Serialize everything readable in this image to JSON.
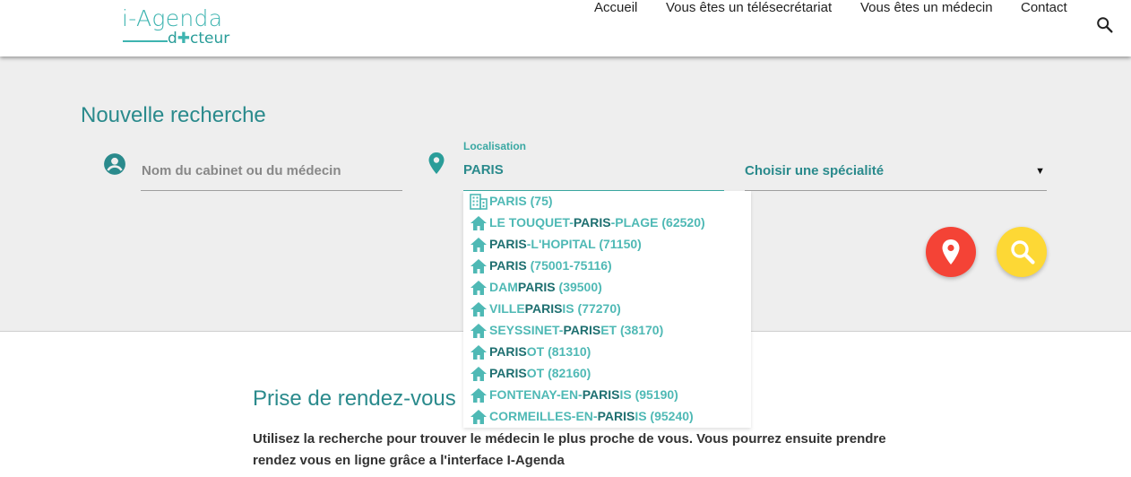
{
  "header": {
    "logo_top": "i-Agenda",
    "logo_bottom_prefix": "d",
    "logo_bottom_suffix": "cteur",
    "nav": [
      {
        "label": "Accueil"
      },
      {
        "label": "Vous êtes un télésecrétariat"
      },
      {
        "label": "Vous êtes un médecin"
      },
      {
        "label": "Contact"
      }
    ],
    "search_icon": "search-icon"
  },
  "search": {
    "title": "Nouvelle recherche",
    "doctor_placeholder": "Nom du cabinet ou du médecin",
    "doctor_icon": "account-circle-icon",
    "location_icon": "location-pin-icon",
    "location_label": "Localisation",
    "location_value": "PARIS",
    "specialty_value": "Choisir une spécialité",
    "specialty_caret": "▼",
    "map_button_icon": "map-pin-icon",
    "search_button_icon": "search-icon"
  },
  "suggestions": [
    {
      "icon": "building-icon",
      "before": "PARIS (75)",
      "match": "",
      "after": ""
    },
    {
      "icon": "home-icon",
      "before": "LE TOUQUET-",
      "match": "PARIS",
      "after": "-PLAGE (62520)"
    },
    {
      "icon": "home-icon",
      "before": "",
      "match": "PARIS",
      "after": "-L'HOPITAL (71150)"
    },
    {
      "icon": "home-icon",
      "before": "",
      "match": "PARIS",
      "after": " (75001-75116)"
    },
    {
      "icon": "home-icon",
      "before": "DAM",
      "match": "PARIS",
      "after": " (39500)"
    },
    {
      "icon": "home-icon",
      "before": "VILLE",
      "match": "PARIS",
      "after": "IS (77270)"
    },
    {
      "icon": "home-icon",
      "before": "SEYSSINET-",
      "match": "PARIS",
      "after": "ET (38170)"
    },
    {
      "icon": "home-icon",
      "before": "",
      "match": "PARIS",
      "after": "OT (81310)"
    },
    {
      "icon": "home-icon",
      "before": "",
      "match": "PARIS",
      "after": "OT (82160)"
    },
    {
      "icon": "home-icon",
      "before": "FONTENAY-EN-",
      "match": "PARIS",
      "after": "IS (95190)"
    },
    {
      "icon": "home-icon",
      "before": "CORMEILLES-EN-",
      "match": "PARIS",
      "after": "IS (95240)"
    }
  ],
  "content": {
    "title": "Prise de rendez-vous",
    "text": "Utilisez la recherche pour trouver le médecin le plus proche de vous. Vous pourrez ensuite prendre rendez vous en ligne grâce a l'interface I-Agenda"
  },
  "colors": {
    "teal": "#2a8a8c",
    "accent": "#3eb4b0",
    "map_button": "#f44336",
    "search_button": "#fdd835",
    "band_bg": "#eeeeee"
  }
}
